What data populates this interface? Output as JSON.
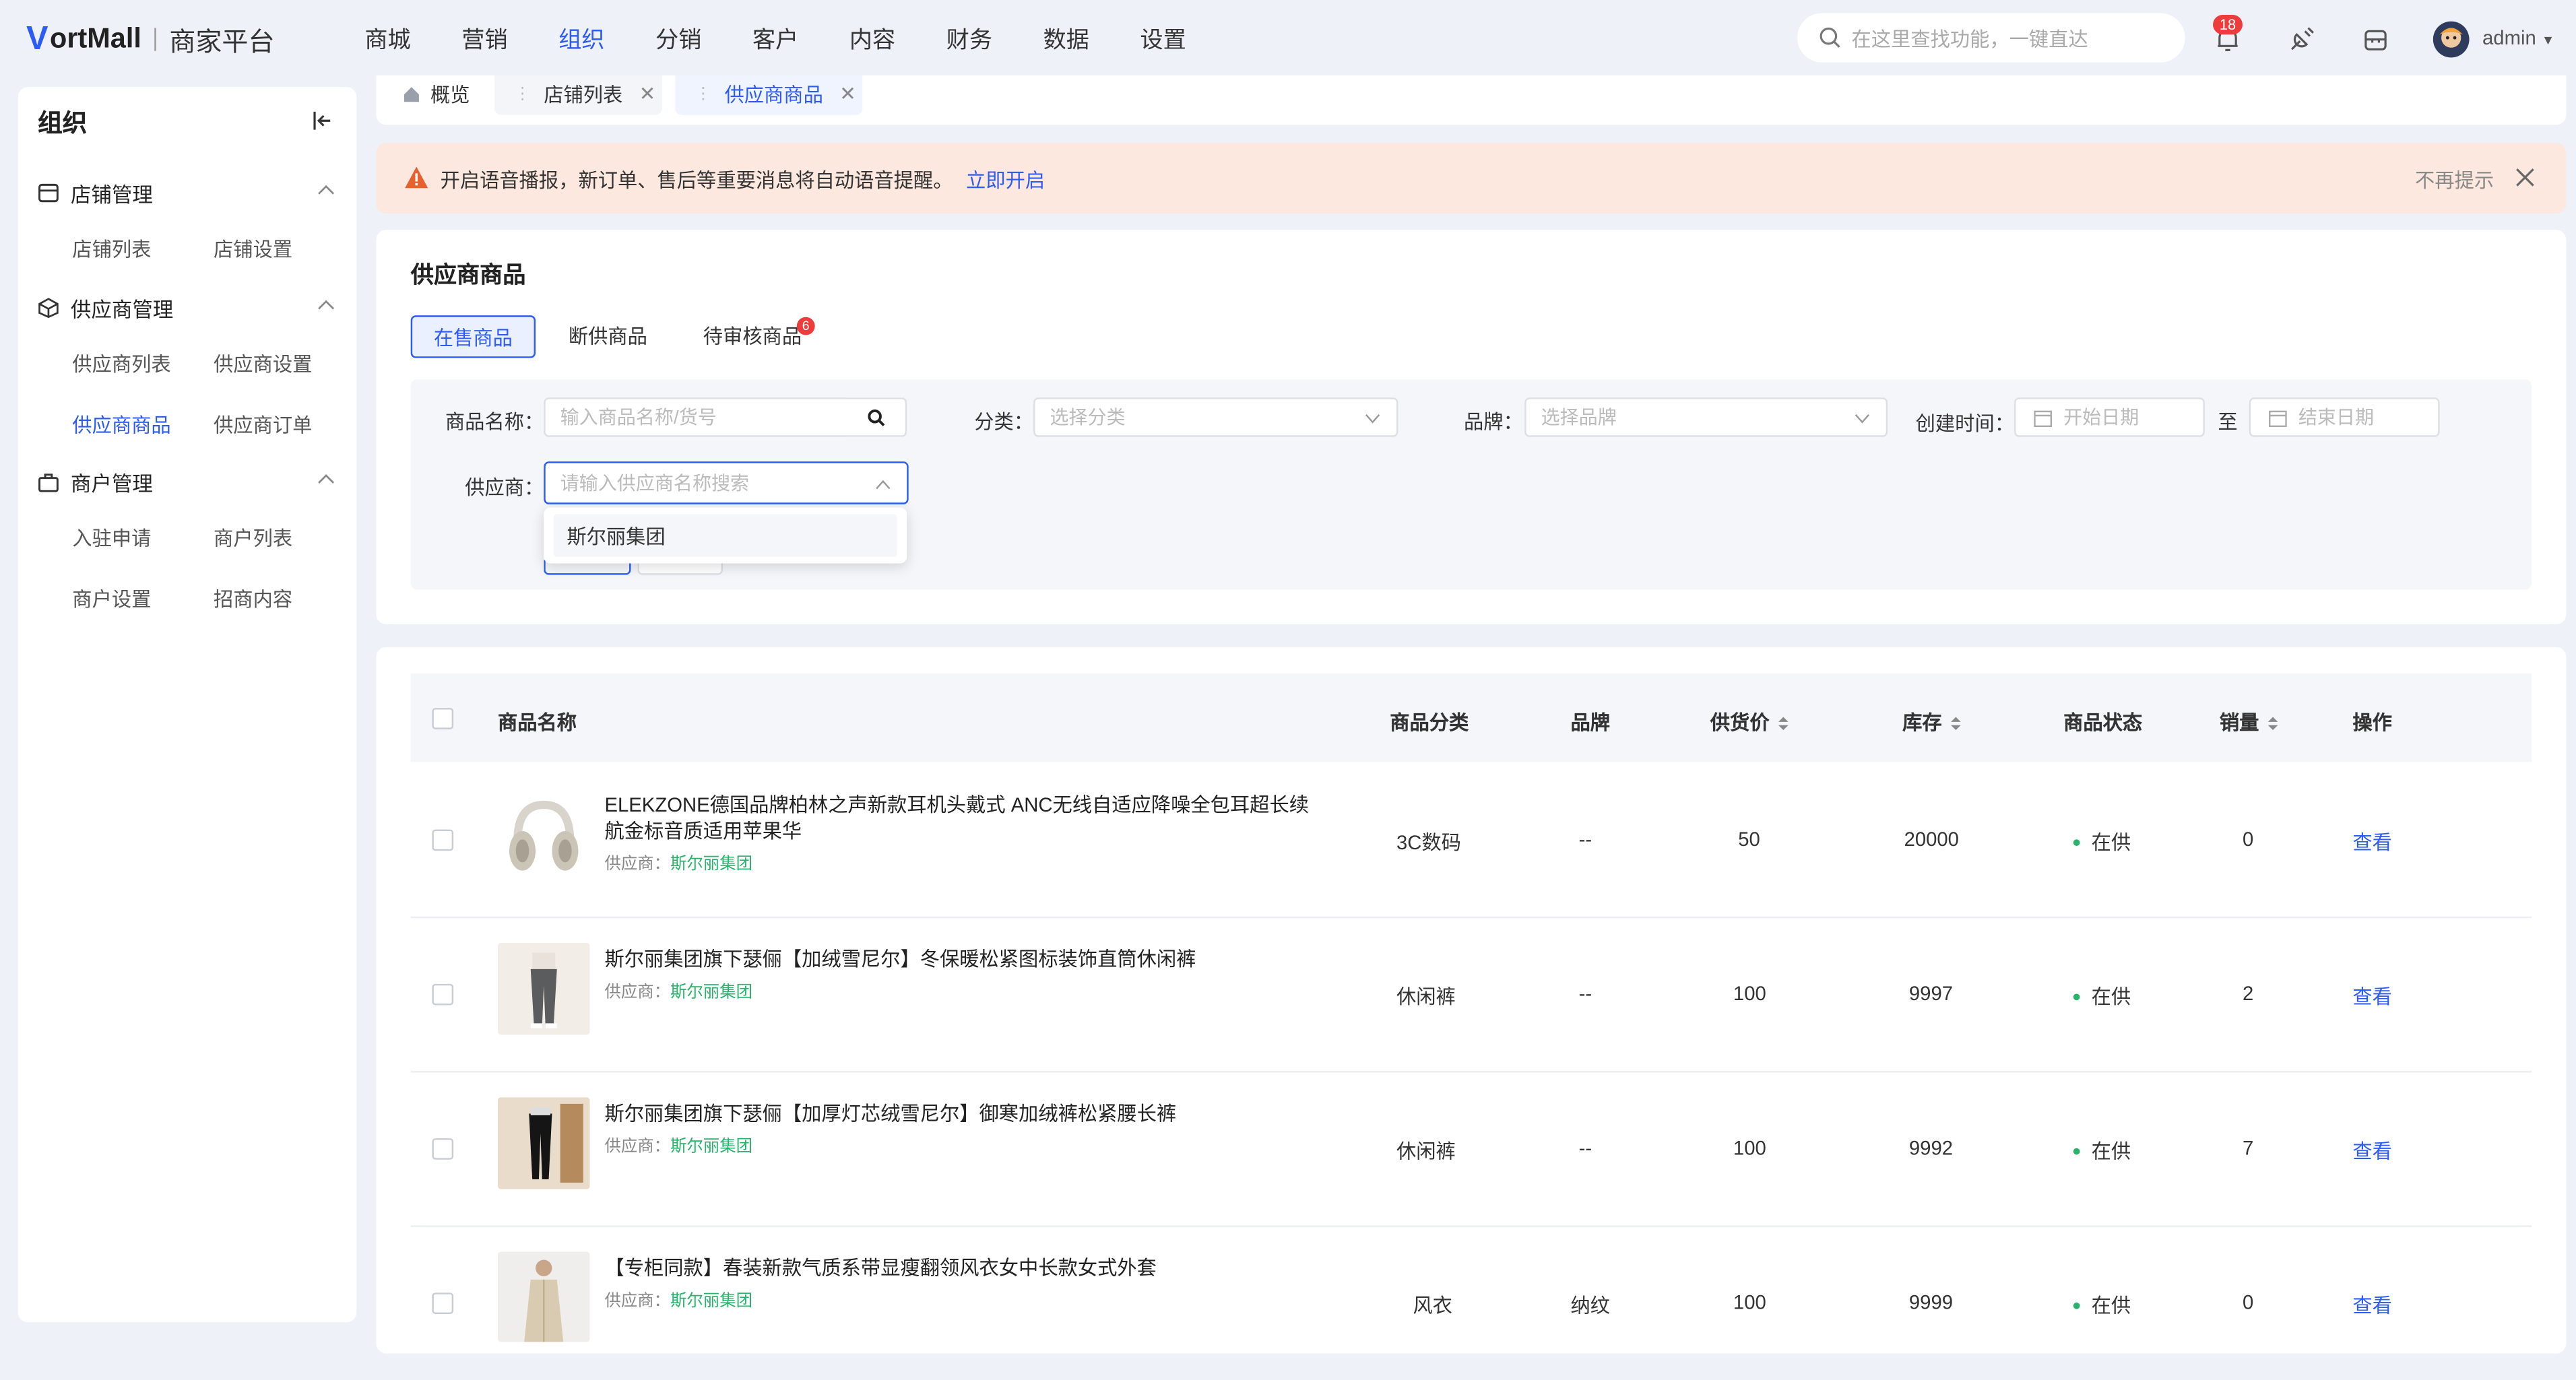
{
  "header": {
    "logo_mark": "V",
    "logo_text": "ortMall",
    "platform": "商家平台",
    "nav": [
      "商城",
      "营销",
      "组织",
      "分销",
      "客户",
      "内容",
      "财务",
      "数据",
      "设置"
    ],
    "active_nav": "组织",
    "search_placeholder": "在这里查找功能，一键直达",
    "notif_count": "18",
    "user": "admin"
  },
  "sidebar": {
    "title": "组织",
    "groups": [
      {
        "label": "店铺管理",
        "items": [
          "店铺列表",
          "店铺设置"
        ]
      },
      {
        "label": "供应商管理",
        "items": [
          "供应商列表",
          "供应商设置",
          "供应商商品",
          "供应商订单"
        ]
      },
      {
        "label": "商户管理",
        "items": [
          "入驻申请",
          "商户列表",
          "商户设置",
          "招商内容"
        ]
      }
    ],
    "active_item": "供应商商品"
  },
  "tabs": [
    {
      "label": "概览"
    },
    {
      "label": "店铺列表"
    },
    {
      "label": "供应商商品"
    }
  ],
  "banner": {
    "message": "开启语音播报，新订单、售后等重要消息将自动语音提醒。",
    "action": "立即开启",
    "dismiss": "不再提示"
  },
  "filter": {
    "title": "供应商商品",
    "status_tabs": [
      "在售商品",
      "断供商品",
      "待审核商品"
    ],
    "pending_badge": "6",
    "name_label": "商品名称：",
    "name_placeholder": "输入商品名称/货号",
    "category_label": "分类：",
    "category_placeholder": "选择分类",
    "brand_label": "品牌：",
    "brand_placeholder": "选择品牌",
    "created_label": "创建时间：",
    "start_placeholder": "开始日期",
    "to": "至",
    "end_placeholder": "结束日期",
    "supplier_label": "供应商：",
    "supplier_placeholder": "请输入供应商名称搜索",
    "supplier_option": "斯尔丽集团"
  },
  "table": {
    "headers": {
      "name": "商品名称",
      "category": "商品分类",
      "brand": "品牌",
      "price": "供货价",
      "stock": "库存",
      "status": "商品状态",
      "sales": "销量",
      "op": "操作"
    },
    "supplier_prefix": "供应商：",
    "rows": [
      {
        "name": "ELEKZONE德国品牌柏林之声新款耳机头戴式 ANC无线自适应降噪全包耳超长续航金标音质适用苹果华",
        "supplier": "斯尔丽集团",
        "category": "3C数码",
        "brand": "--",
        "price": "50",
        "stock": "20000",
        "status": "在供",
        "sales": "0",
        "op": "查看",
        "thumb": "headphones-image"
      },
      {
        "name": "斯尔丽集团旗下瑟俪【加绒雪尼尔】冬保暖松紧图标装饰直筒休闲裤",
        "supplier": "斯尔丽集团",
        "category": "休闲裤",
        "brand": "--",
        "price": "100",
        "stock": "9997",
        "status": "在供",
        "sales": "2",
        "op": "查看",
        "thumb": "pants-image"
      },
      {
        "name": "斯尔丽集团旗下瑟俪【加厚灯芯绒雪尼尔】御寒加绒裤松紧腰长裤",
        "supplier": "斯尔丽集团",
        "category": "休闲裤",
        "brand": "--",
        "price": "100",
        "stock": "9992",
        "status": "在供",
        "sales": "7",
        "op": "查看",
        "thumb": "black-pants-image"
      },
      {
        "name": "【专柜同款】春装新款气质系带显瘦翻领风衣女中长款女式外套",
        "supplier": "斯尔丽集团",
        "category": "风衣",
        "brand": "纳纹",
        "price": "100",
        "stock": "9999",
        "status": "在供",
        "sales": "0",
        "op": "查看",
        "thumb": "trench-coat-image"
      }
    ]
  },
  "colors": {
    "primary": "#2c5cf5",
    "success": "#27b36a",
    "danger": "#ee3b3b",
    "banner_bg": "#fde8df"
  }
}
